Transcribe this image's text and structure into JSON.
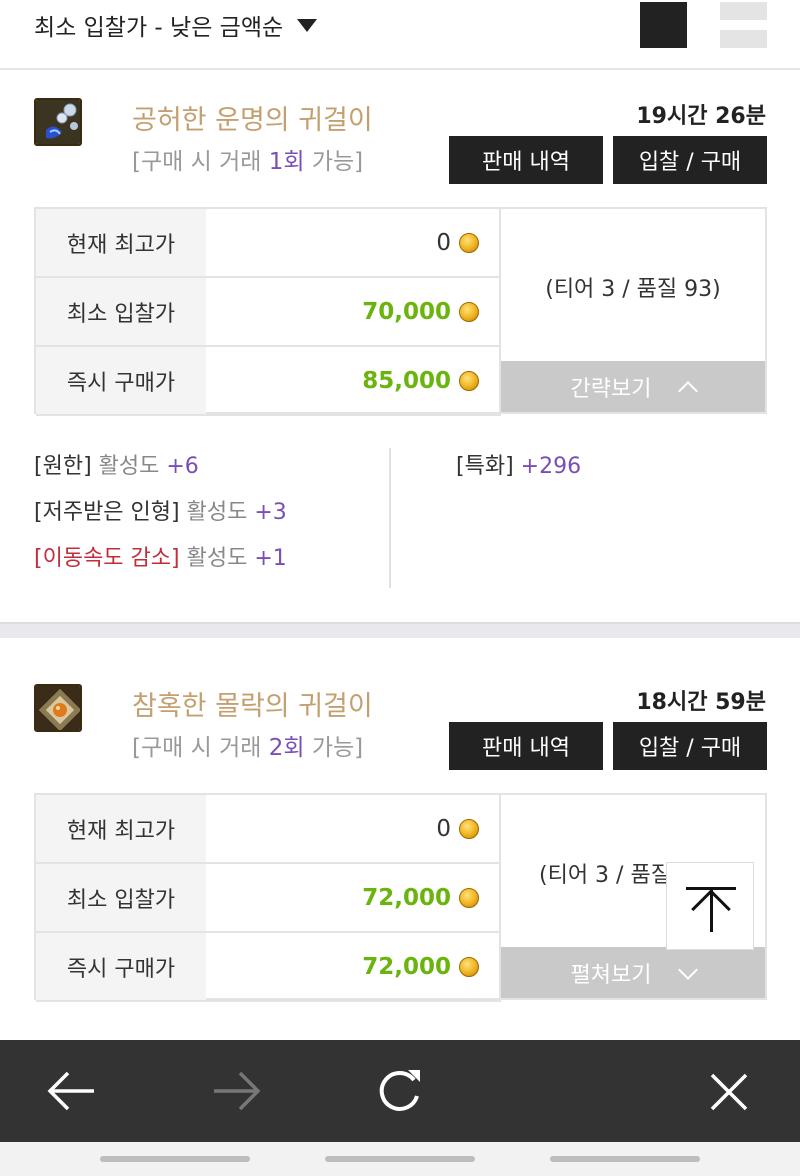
{
  "sort": {
    "label": "최소 입찰가 - 낮은 금액순"
  },
  "items": [
    {
      "name": "공허한 운명의 귀걸이",
      "trade_prefix": "[구매 시 거래 ",
      "trade_count": "1회",
      "trade_suffix": " 가능]",
      "time_left": "19시간 26분",
      "history_label": "판매 내역",
      "bid_label": "입찰 / 구매",
      "prices": [
        {
          "label": "현재 최고가",
          "value": "0"
        },
        {
          "label": "최소 입찰가",
          "value": "70,000"
        },
        {
          "label": "즉시 구매가",
          "value": "85,000"
        }
      ],
      "tier": "(티어 3 / 품질 93)",
      "toggle_label": "간략보기",
      "effects_left": [
        {
          "name": "[원한]",
          "stat": " 활성도 ",
          "value": "+6"
        },
        {
          "name": "[저주받은 인형]",
          "stat": " 활성도 ",
          "value": "+3"
        },
        {
          "name": "[이동속도 감소]",
          "stat": " 활성도 ",
          "value": "+1"
        }
      ],
      "effects_right": [
        {
          "name": "[특화]",
          "value": " +296"
        }
      ]
    },
    {
      "name": "참혹한 몰락의 귀걸이",
      "trade_prefix": "[구매 시 거래 ",
      "trade_count": "2회",
      "trade_suffix": " 가능]",
      "time_left": "18시간 59분",
      "history_label": "판매 내역",
      "bid_label": "입찰 / 구매",
      "prices": [
        {
          "label": "현재 최고가",
          "value": "0"
        },
        {
          "label": "최소 입찰가",
          "value": "72,000"
        },
        {
          "label": "즉시 구매가",
          "value": "72,000"
        }
      ],
      "tier": "(티어 3 / 품질",
      "toggle_label": "펼쳐보기"
    }
  ],
  "colors": {
    "item_name": "#c4a071",
    "trade_count": "#7a4fb5",
    "price_green": "#6bb40e",
    "negative_effect": "#c32d3b",
    "browser_bar": "#333333"
  },
  "icons": {
    "sort_caret": "caret-down-icon",
    "back": "arrow-left-icon",
    "forward": "arrow-right-icon",
    "reload": "reload-icon",
    "close": "close-icon",
    "scroll_top": "scroll-to-top-icon",
    "coin": "gold-coin-icon"
  }
}
